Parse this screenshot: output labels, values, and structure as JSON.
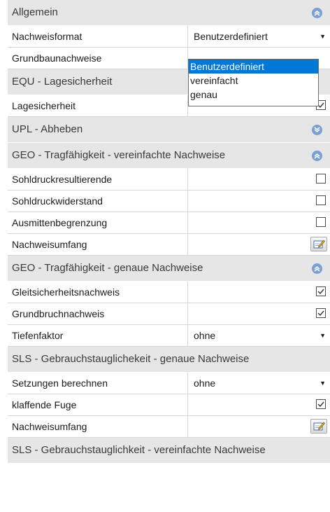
{
  "colors": {
    "section_bg": "#e6e6e6",
    "collapse_icon": "#7b9fd4",
    "selection": "#0078d7"
  },
  "sections": {
    "allgemein": {
      "title": "Allgemein",
      "collapse_icon": "chevron-up",
      "rows": {
        "nachweisformat": {
          "label": "Nachweisformat",
          "value": "Benutzerdefiniert"
        },
        "grundbau": {
          "label": "Grundbaunachweise"
        }
      }
    },
    "equ": {
      "title": "EQU - Lagesicherheit",
      "rows": {
        "lagesicherheit": {
          "label": "Lagesicherheit",
          "checked": true
        }
      }
    },
    "upl": {
      "title": "UPL - Abheben",
      "collapse_icon": "chevron-down"
    },
    "geo_verein": {
      "title": "GEO - Tragfähigkeit - vereinfachte Nachweise",
      "collapse_icon": "chevron-up",
      "rows": {
        "sohldruckresultierende": {
          "label": "Sohldruckresultierende",
          "checked": false
        },
        "sohldruckwiderstand": {
          "label": "Sohldruckwiderstand",
          "checked": false
        },
        "ausmitten": {
          "label": "Ausmittenbegrenzung",
          "checked": false
        },
        "umfang": {
          "label": "Nachweisumfang"
        }
      }
    },
    "geo_genau": {
      "title": "GEO - Tragfähigkeit - genaue Nachweise",
      "collapse_icon": "chevron-up",
      "rows": {
        "gleit": {
          "label": "Gleitsicherheitsnachweis",
          "checked": true
        },
        "grundbruch": {
          "label": "Grundbruchnachweis",
          "checked": true
        },
        "tiefenfaktor": {
          "label": "Tiefenfaktor",
          "value": "ohne"
        }
      }
    },
    "sls_genau": {
      "title": "SLS - Gebrauchstauglichekeit - genaue Nachweise",
      "rows": {
        "setzungen": {
          "label": "Setzungen berechnen",
          "value": "ohne"
        },
        "fuge": {
          "label": "klaffende Fuge",
          "checked": true
        },
        "umfang": {
          "label": "Nachweisumfang"
        }
      }
    },
    "sls_verein": {
      "title": "SLS - Gebrauchstauglichkeit - vereinfachte Nachweise"
    }
  },
  "dropdown": {
    "options": [
      "Benutzerdefiniert",
      "vereinfacht",
      "genau"
    ],
    "selected": "Benutzerdefiniert"
  }
}
